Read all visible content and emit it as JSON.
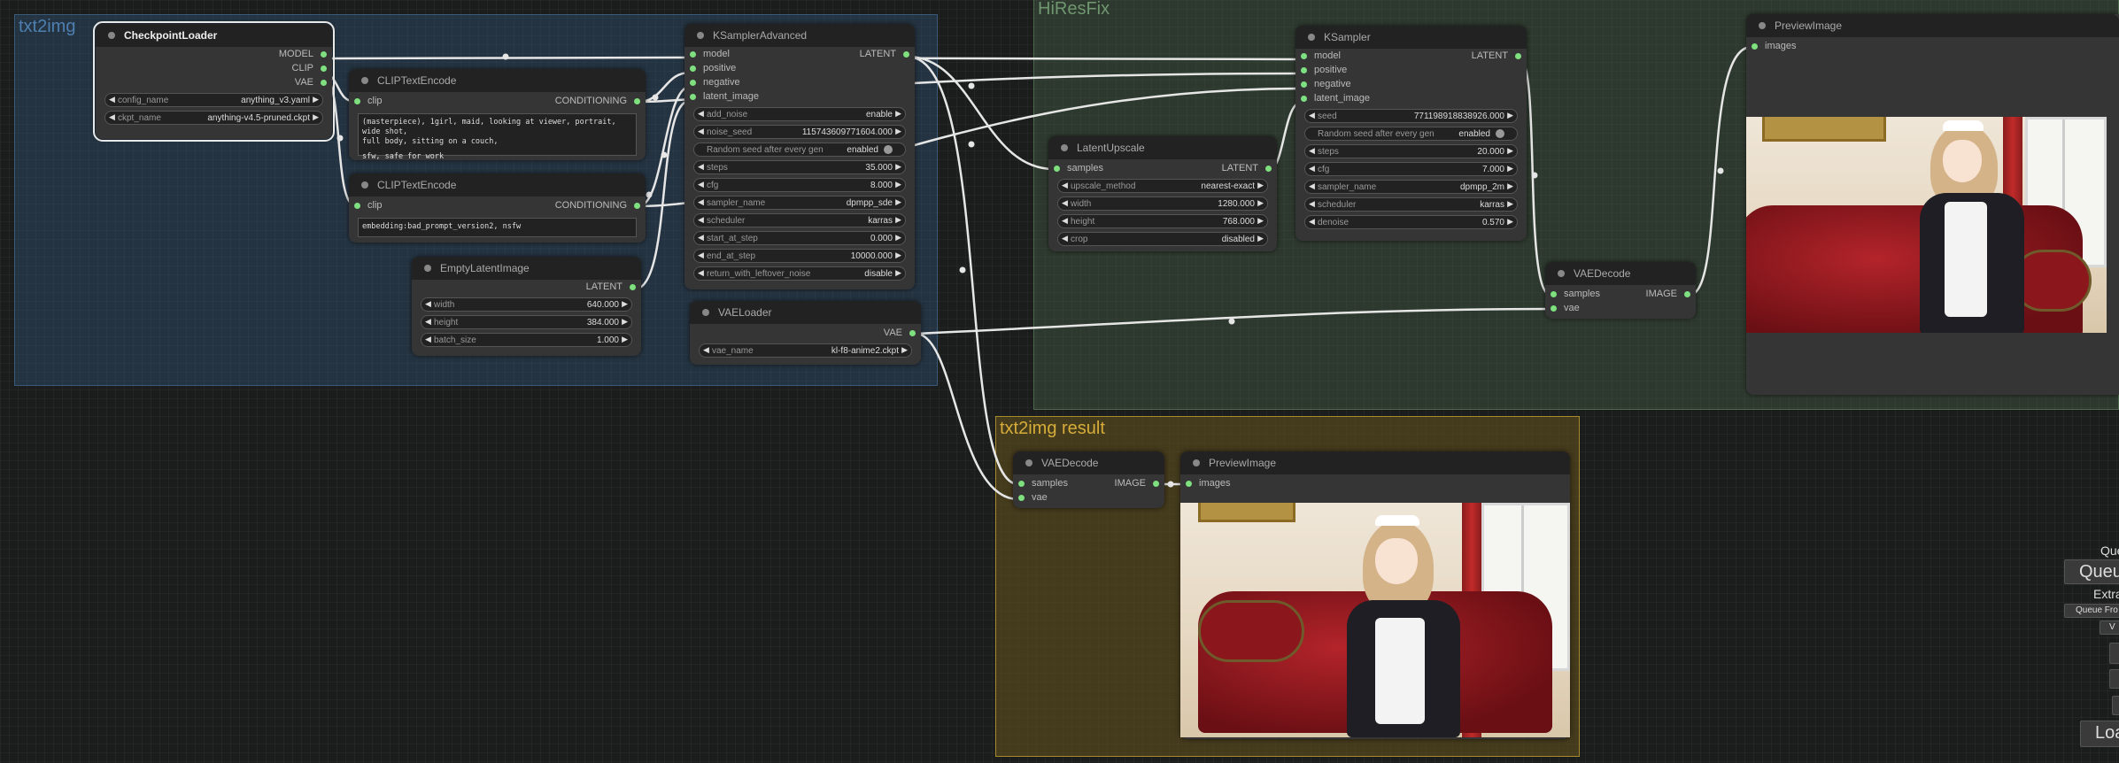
{
  "groups": {
    "txt2img": "txt2img",
    "hires": "HiResFix",
    "result": "txt2img result"
  },
  "checkpoint_loader": {
    "title": "CheckpointLoader",
    "outputs": [
      "MODEL",
      "CLIP",
      "VAE"
    ],
    "widgets": [
      {
        "label": "config_name",
        "value": "anything_v3.yaml"
      },
      {
        "label": "ckpt_name",
        "value": "anything-v4.5-pruned.ckpt"
      }
    ]
  },
  "clip_positive": {
    "title": "CLIPTextEncode",
    "input": "clip",
    "output": "CONDITIONING",
    "text_line1": "(masterpiece), 1girl, maid, looking at viewer, portrait, wide shot,",
    "text_line2": "full body, sitting on a couch,",
    "text_line3": "",
    "text_line4": "sfw, safe for work"
  },
  "clip_negative": {
    "title": "CLIPTextEncode",
    "input": "clip",
    "output": "CONDITIONING",
    "text": "embedding:bad_prompt_version2, nsfw"
  },
  "empty_latent": {
    "title": "EmptyLatentImage",
    "output": "LATENT",
    "widgets": [
      {
        "label": "width",
        "value": "640.000"
      },
      {
        "label": "height",
        "value": "384.000"
      },
      {
        "label": "batch_size",
        "value": "1.000"
      }
    ]
  },
  "ksampler_adv": {
    "title": "KSamplerAdvanced",
    "inputs": [
      "model",
      "positive",
      "negative",
      "latent_image"
    ],
    "output": "LATENT",
    "widgets": [
      {
        "label": "add_noise",
        "value": "enable"
      },
      {
        "label": "noise_seed",
        "value": "115743609771604.000"
      },
      {
        "label": "Random seed after every gen",
        "value": "enabled",
        "toggle": true
      },
      {
        "label": "steps",
        "value": "35.000"
      },
      {
        "label": "cfg",
        "value": "8.000"
      },
      {
        "label": "sampler_name",
        "value": "dpmpp_sde"
      },
      {
        "label": "scheduler",
        "value": "karras"
      },
      {
        "label": "start_at_step",
        "value": "0.000"
      },
      {
        "label": "end_at_step",
        "value": "10000.000"
      },
      {
        "label": "return_with_leftover_noise",
        "value": "disable"
      }
    ]
  },
  "vae_loader": {
    "title": "VAELoader",
    "output": "VAE",
    "widgets": [
      {
        "label": "vae_name",
        "value": "kl-f8-anime2.ckpt"
      }
    ]
  },
  "latent_upscale": {
    "title": "LatentUpscale",
    "input": "samples",
    "output": "LATENT",
    "widgets": [
      {
        "label": "upscale_method",
        "value": "nearest-exact"
      },
      {
        "label": "width",
        "value": "1280.000"
      },
      {
        "label": "height",
        "value": "768.000"
      },
      {
        "label": "crop",
        "value": "disabled"
      }
    ]
  },
  "ksampler": {
    "title": "KSampler",
    "inputs": [
      "model",
      "positive",
      "negative",
      "latent_image"
    ],
    "output": "LATENT",
    "widgets": [
      {
        "label": "seed",
        "value": "771198918838926.000"
      },
      {
        "label": "Random seed after every gen",
        "value": "enabled",
        "toggle": true
      },
      {
        "label": "steps",
        "value": "20.000"
      },
      {
        "label": "cfg",
        "value": "7.000"
      },
      {
        "label": "sampler_name",
        "value": "dpmpp_2m"
      },
      {
        "label": "scheduler",
        "value": "karras"
      },
      {
        "label": "denoise",
        "value": "0.570"
      }
    ]
  },
  "vae_decode_hires": {
    "title": "VAEDecode",
    "inputs": [
      "samples",
      "vae"
    ],
    "output": "IMAGE"
  },
  "preview_hires": {
    "title": "PreviewImage",
    "input": "images"
  },
  "vae_decode_result": {
    "title": "VAEDecode",
    "inputs": [
      "samples",
      "vae"
    ],
    "output": "IMAGE"
  },
  "preview_result": {
    "title": "PreviewImage",
    "input": "images"
  },
  "queue_panel": {
    "label_queue": "Queu",
    "queue_button": "Queu",
    "label_extra": "Extra",
    "queue_front": "Queue Fro",
    "view": "V",
    "load": "Loa"
  },
  "colors": {
    "link": "#e8e8e8",
    "slot": "#7fe07f",
    "node_bg": "#353535",
    "title_bg": "#222222"
  }
}
